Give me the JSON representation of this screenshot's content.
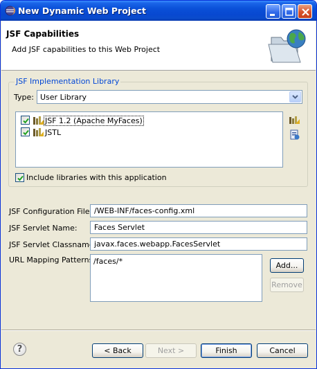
{
  "window": {
    "title": "New Dynamic Web Project"
  },
  "header": {
    "title": "JSF Capabilities",
    "subtitle": "Add JSF capabilities to this Web Project",
    "icon": "folder-globe-icon"
  },
  "library_group": {
    "legend": "JSF Implementation Library",
    "type_label": "Type:",
    "type_value": "User Library",
    "libraries": [
      {
        "label": "JSF 1.2 (Apache MyFaces)",
        "checked": true,
        "selected": true
      },
      {
        "label": "JSTL",
        "checked": true,
        "selected": false
      }
    ],
    "include_label": "Include libraries with this application",
    "include_checked": true
  },
  "fields": {
    "config_file_label": "JSF Configuration File:",
    "config_file_value": "/WEB-INF/faces-config.xml",
    "servlet_name_label": "JSF Servlet Name:",
    "servlet_name_value": "Faces Servlet",
    "servlet_class_label": "JSF Servlet Classname:",
    "servlet_class_value": "javax.faces.webapp.FacesServlet",
    "url_patterns_label": "URL Mapping Patterns:",
    "url_patterns_value": "/faces/*",
    "add_label": "Add...",
    "remove_label": "Remove"
  },
  "footer": {
    "help_glyph": "?",
    "back_label": "< Back",
    "next_label": "Next >",
    "finish_label": "Finish",
    "cancel_label": "Cancel"
  },
  "colors": {
    "title_bar": "#0a50d8",
    "dialog_bg": "#ece9d8",
    "group_legend": "#0046d5"
  }
}
